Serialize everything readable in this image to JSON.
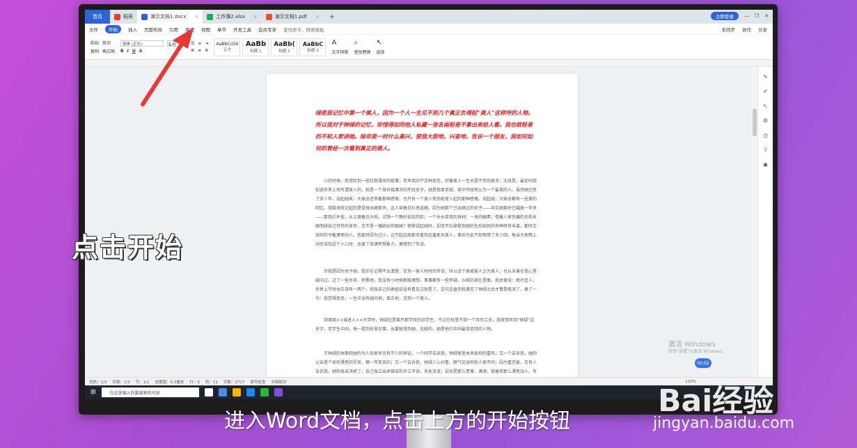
{
  "tabs": {
    "home": "首页",
    "items": [
      {
        "label": "稻壳"
      },
      {
        "label": "演示文档1.docx"
      },
      {
        "label": "工作簿2.xlsx"
      },
      {
        "label": "演示文档1.pdf"
      }
    ],
    "login": "立即登录"
  },
  "menu": {
    "items": [
      "文件",
      "开始",
      "插入",
      "页面布局",
      "引用",
      "审阅",
      "视图",
      "章节",
      "开发工具",
      "会员专享"
    ],
    "search": "查找命令、搜索模板",
    "right": [
      "未同步",
      "协作",
      "分享"
    ]
  },
  "ribbon": {
    "paste": "粘贴",
    "cut": "剪切",
    "copy": "复制",
    "format_painter": "格式刷",
    "font": "宋体 (正文)",
    "size": "五号",
    "styles": [
      {
        "sample": "AaBbCcDd",
        "label": "正文"
      },
      {
        "sample": "AaBb",
        "label": "标题 1"
      },
      {
        "sample": "AaBb(",
        "label": "标题 2"
      },
      {
        "sample": "AaBbC",
        "label": "标题 3"
      }
    ],
    "text_tools": "文字排版",
    "find_replace": "查找替换",
    "select": "选择"
  },
  "document": {
    "red_paragraph": "绿是我记忆中第一个美人，因为一个人一生见不到几个真正负得起“美人”这称呼的人物。所以我对于钟绿的记忆，珍惜得如同他人私藏一张名画轻易不拿出来给人看。我也就轻易的不和人家讲她。除非是一时什么高兴，使我大胆地，兴奋地，告诉一个朋友，我如何如何的曾经一次看到真正的美人。",
    "paragraphs": [
      "小的时候，我常听到一些红颜薄命的故事，老早我印下这种迷信，好像美人一生总是不幸的居多，尤其是，最初叫我知道世界上有所谓美人的，就是一个身世极凄凉的年轻女子，她是我家老戚，家中传统地认为一个最美的人。虽然她已死了多少年，说起她来，大家总还带着那种感慨，也只有一个美人死后能使人起的那种感慨。说起她，大家总都有一些美的回忆。我脑海常记起的是祖母出嫁那天，这人穿着白衫来送嫁。因为她那个已出嫁过的女子——其实她那时已孀居一年多——那我们乡俗，从上理着白头帕，试想一个静好如花的脸；一个长长苗窕的身材；一身的缟素；借着人家伤痛的夫和未嫁而她自己可怜的身世，怎不是一幅绝妙的图画？假使说起她时，却还不忘掉提到她的生后如何的有种特有丰姿，那时又如何的令敏凄恻动人。我那时因为过小，记不起这般那天看到这番那天美人，事后为此不知惋惜了多少回。每当大家晚上闲坐谈到这个人儿时，总害了我满怀想象力，莫想到了伤深。",
      "许就是因为关于她，我实在记得不太清楚，仅凭一家人时时的传说，所以这个表戚美人之为美人，也从未曾在我心里疑问过，过了一些岁月，积累地，我没有小时候那般理想，事事都有一些怀疑，沙纸的揉在里面。我总爱说：绝代佳人，世界上不时总应该有一两个，但我自己的表姐却没有看见过就是了。这句话直到我遇见了钟绿之后才算是取消了，换了一句：我觉得我幸，一生中没有疑问地，真正地，见到一个美人。",
      "到美国××城进入××大学时，钟绿已是离开那学校的旧学生，不过在校里不到一个月的工夫，我就常听到“钟绿”这名字，老学生中间，每一提到校里旧事，总要联想到她，无疑的，她是他们中间最受崇拜的人物。",
      "于钟绿的体面和她的为人及家世也有不少的神话，一个同学告诉我，钟绿家里本来如何的富有；又一个告诉我，她的父亲是个如何漂亮的军官，哪一年死去的；又一个告诉我，钟绿少么好看，脾气又如何和人家不同；因为看恋爱，又有人告诉我，她和母亲决绝了，自己独立出来做苦的半工半读，多处流浪；却总是那么贵傻，满洒，穿着带那么漂亮动人。有人"
    ]
  },
  "status_bar": {
    "page": "页码：1/3",
    "section": "页面：1/3",
    "section2": "节：1/1",
    "position": "设置值：6.3厘米",
    "line": "行：6",
    "col": "列：12",
    "words": "字数：2717",
    "spell": "拼写检查",
    "proof": "文档校对",
    "zoom": "110%"
  },
  "taskbar": {
    "search": "在这里输入你要搜索的内容"
  },
  "watermark": {
    "activate": "激活 Windows",
    "activate_sub": "转到“设置”以激活 Windows。",
    "badge": "00:02"
  },
  "overlay": {
    "click_text": "点击开始",
    "subtitle": "进入Word文档，点击上方的开始按钮",
    "brand": "Bai经验",
    "url": "jingyan.baidu.com"
  },
  "colors": {
    "accent": "#2f64d6",
    "red_text": "#e02020",
    "arrow": "#e53935"
  }
}
